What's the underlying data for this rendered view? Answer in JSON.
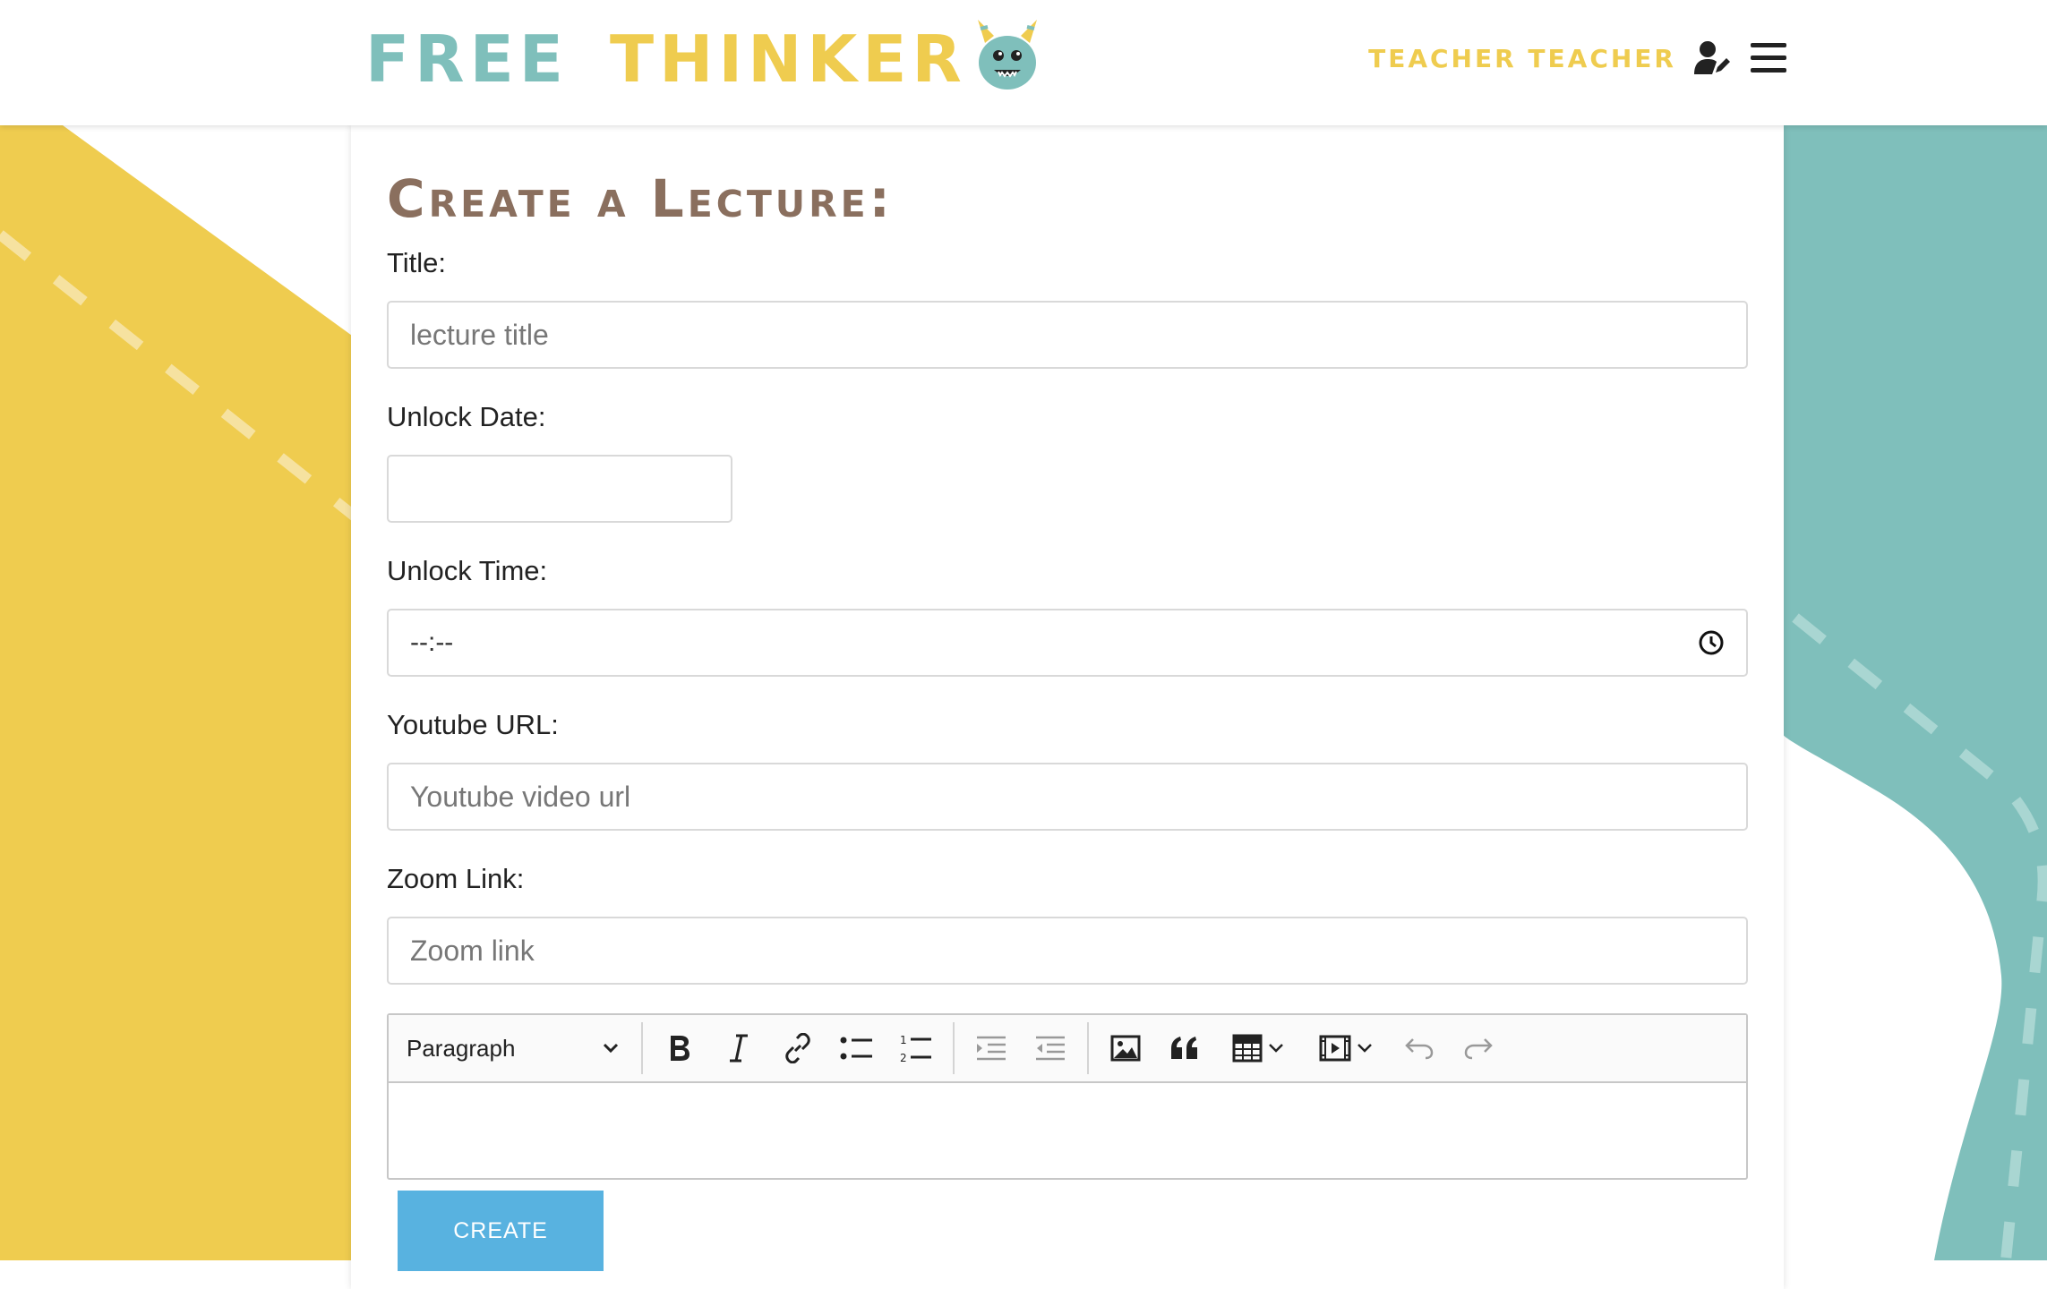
{
  "header": {
    "logo_word1": "FREE",
    "logo_word2": "THINKER",
    "user_name": "Teacher Teacher",
    "user_icon": "user-edit-icon",
    "menu_icon": "hamburger-menu-icon"
  },
  "form": {
    "heading": "Create a Lecture:",
    "title_label": "Title:",
    "title_placeholder": "lecture title",
    "date_label": "Unlock Date:",
    "date_value": "",
    "time_label": "Unlock Time:",
    "time_value": "--:--",
    "youtube_label": "Youtube URL:",
    "youtube_placeholder": "Youtube video url",
    "zoom_label": "Zoom Link:",
    "zoom_placeholder": "Zoom link",
    "create_label": "CREATE"
  },
  "editor": {
    "paragraph_label": "Paragraph",
    "toolbar_icons": [
      "bold-icon",
      "italic-icon",
      "link-icon",
      "bulleted-list-icon",
      "numbered-list-icon",
      "outdent-icon",
      "indent-icon",
      "image-icon",
      "quote-icon",
      "table-icon",
      "media-icon",
      "undo-icon",
      "redo-icon"
    ]
  },
  "colors": {
    "yellow": "#efcc4f",
    "teal": "#7fbfbb",
    "brown": "#8a6f5e",
    "button_blue": "#58b2e0"
  }
}
